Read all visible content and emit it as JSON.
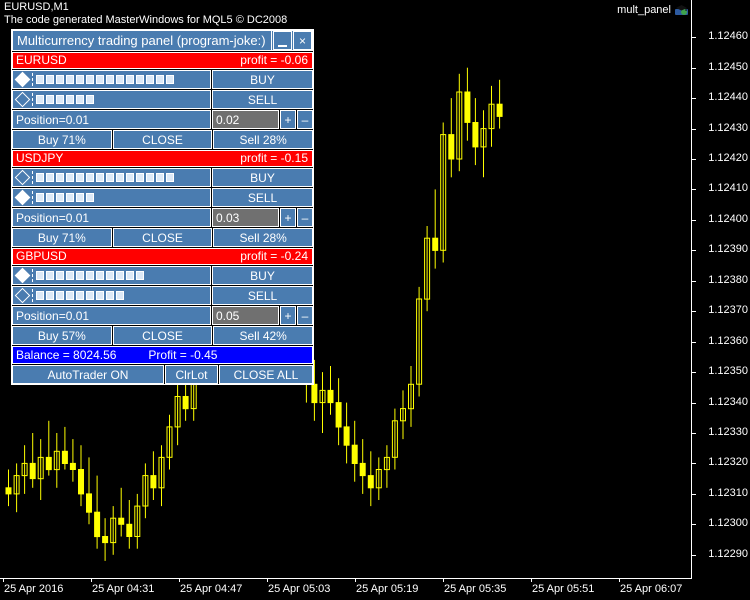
{
  "chart": {
    "symbol_label": "EURUSD,M1",
    "copyright": "The code generated MasterWindows for MQL5 © DC2008",
    "indicator_label": "mult_panel",
    "indicator_icon": "expert-advisor-icon",
    "background": "#000000",
    "candle_color": "#FFFF00"
  },
  "chart_data": {
    "type": "candlestick",
    "title": "EURUSD,M1",
    "xlabel": "",
    "ylabel": "",
    "grid": false,
    "legend": "none",
    "ylim": [
      1.12285,
      1.12465
    ],
    "price_ticks": [
      "1.12460",
      "1.12450",
      "1.12440",
      "1.12430",
      "1.12420",
      "1.12410",
      "1.12400",
      "1.12390",
      "1.12380",
      "1.12370",
      "1.12360",
      "1.12350",
      "1.12340",
      "1.12330",
      "1.12320",
      "1.12310",
      "1.12300",
      "1.12290"
    ],
    "time_ticks": [
      "25 Apr 2016",
      "25 Apr 04:31",
      "25 Apr 04:47",
      "25 Apr 05:03",
      "25 Apr 05:19",
      "25 Apr 05:35",
      "25 Apr 05:51",
      "25 Apr 06:07"
    ],
    "candles": [
      {
        "o": 1.12312,
        "h": 1.12318,
        "l": 1.12306,
        "c": 1.1231
      },
      {
        "o": 1.1231,
        "h": 1.1232,
        "l": 1.12304,
        "c": 1.12316
      },
      {
        "o": 1.12316,
        "h": 1.12326,
        "l": 1.1231,
        "c": 1.1232
      },
      {
        "o": 1.1232,
        "h": 1.1233,
        "l": 1.12312,
        "c": 1.12315
      },
      {
        "o": 1.12315,
        "h": 1.12328,
        "l": 1.12308,
        "c": 1.12322
      },
      {
        "o": 1.12322,
        "h": 1.12334,
        "l": 1.12316,
        "c": 1.12318
      },
      {
        "o": 1.12318,
        "h": 1.1233,
        "l": 1.12312,
        "c": 1.12324
      },
      {
        "o": 1.12324,
        "h": 1.12332,
        "l": 1.12318,
        "c": 1.1232
      },
      {
        "o": 1.1232,
        "h": 1.12328,
        "l": 1.12314,
        "c": 1.12318
      },
      {
        "o": 1.12318,
        "h": 1.12326,
        "l": 1.12306,
        "c": 1.1231
      },
      {
        "o": 1.1231,
        "h": 1.12322,
        "l": 1.123,
        "c": 1.12304
      },
      {
        "o": 1.12304,
        "h": 1.12316,
        "l": 1.12292,
        "c": 1.12296
      },
      {
        "o": 1.12296,
        "h": 1.12302,
        "l": 1.12288,
        "c": 1.12294
      },
      {
        "o": 1.12294,
        "h": 1.12306,
        "l": 1.1229,
        "c": 1.12302
      },
      {
        "o": 1.12302,
        "h": 1.12312,
        "l": 1.12296,
        "c": 1.123
      },
      {
        "o": 1.123,
        "h": 1.12308,
        "l": 1.12292,
        "c": 1.12296
      },
      {
        "o": 1.12296,
        "h": 1.1231,
        "l": 1.12292,
        "c": 1.12306
      },
      {
        "o": 1.12306,
        "h": 1.1232,
        "l": 1.12302,
        "c": 1.12316
      },
      {
        "o": 1.12316,
        "h": 1.12324,
        "l": 1.12308,
        "c": 1.12312
      },
      {
        "o": 1.12312,
        "h": 1.12326,
        "l": 1.12306,
        "c": 1.12322
      },
      {
        "o": 1.12322,
        "h": 1.12336,
        "l": 1.12318,
        "c": 1.12332
      },
      {
        "o": 1.12332,
        "h": 1.12346,
        "l": 1.12326,
        "c": 1.12342
      },
      {
        "o": 1.12342,
        "h": 1.12352,
        "l": 1.12334,
        "c": 1.12338
      },
      {
        "o": 1.12338,
        "h": 1.1236,
        "l": 1.12334,
        "c": 1.12356
      },
      {
        "o": 1.12356,
        "h": 1.12396,
        "l": 1.12352,
        "c": 1.12392
      },
      {
        "o": 1.12392,
        "h": 1.12412,
        "l": 1.12386,
        "c": 1.12408
      },
      {
        "o": 1.12408,
        "h": 1.12424,
        "l": 1.12396,
        "c": 1.12404
      },
      {
        "o": 1.12404,
        "h": 1.12452,
        "l": 1.124,
        "c": 1.12446
      },
      {
        "o": 1.12446,
        "h": 1.12458,
        "l": 1.1243,
        "c": 1.12436
      },
      {
        "o": 1.12436,
        "h": 1.12448,
        "l": 1.12414,
        "c": 1.1242
      },
      {
        "o": 1.1242,
        "h": 1.12432,
        "l": 1.12406,
        "c": 1.12412
      },
      {
        "o": 1.12412,
        "h": 1.12424,
        "l": 1.124,
        "c": 1.12406
      },
      {
        "o": 1.12406,
        "h": 1.12418,
        "l": 1.1238,
        "c": 1.12386
      },
      {
        "o": 1.12386,
        "h": 1.12392,
        "l": 1.12366,
        "c": 1.12372
      },
      {
        "o": 1.12372,
        "h": 1.1238,
        "l": 1.1236,
        "c": 1.12366
      },
      {
        "o": 1.12366,
        "h": 1.12374,
        "l": 1.12356,
        "c": 1.12362
      },
      {
        "o": 1.12362,
        "h": 1.1237,
        "l": 1.12348,
        "c": 1.12354
      },
      {
        "o": 1.12354,
        "h": 1.12362,
        "l": 1.1234,
        "c": 1.12346
      },
      {
        "o": 1.12346,
        "h": 1.12354,
        "l": 1.12334,
        "c": 1.1234
      },
      {
        "o": 1.1234,
        "h": 1.1235,
        "l": 1.1233,
        "c": 1.12344
      },
      {
        "o": 1.12344,
        "h": 1.12352,
        "l": 1.12336,
        "c": 1.1234
      },
      {
        "o": 1.1234,
        "h": 1.12348,
        "l": 1.12326,
        "c": 1.12332
      },
      {
        "o": 1.12332,
        "h": 1.1234,
        "l": 1.1232,
        "c": 1.12326
      },
      {
        "o": 1.12326,
        "h": 1.12334,
        "l": 1.12314,
        "c": 1.1232
      },
      {
        "o": 1.1232,
        "h": 1.12328,
        "l": 1.1231,
        "c": 1.12316
      },
      {
        "o": 1.12316,
        "h": 1.12324,
        "l": 1.12306,
        "c": 1.12312
      },
      {
        "o": 1.12312,
        "h": 1.12322,
        "l": 1.12308,
        "c": 1.12318
      },
      {
        "o": 1.12318,
        "h": 1.12326,
        "l": 1.12312,
        "c": 1.12322
      },
      {
        "o": 1.12322,
        "h": 1.12338,
        "l": 1.12318,
        "c": 1.12334
      },
      {
        "o": 1.12334,
        "h": 1.12344,
        "l": 1.12328,
        "c": 1.12338
      },
      {
        "o": 1.12338,
        "h": 1.12352,
        "l": 1.12332,
        "c": 1.12346
      },
      {
        "o": 1.12346,
        "h": 1.12378,
        "l": 1.12342,
        "c": 1.12374
      },
      {
        "o": 1.12374,
        "h": 1.12398,
        "l": 1.1237,
        "c": 1.12394
      },
      {
        "o": 1.12394,
        "h": 1.1241,
        "l": 1.12384,
        "c": 1.1239
      },
      {
        "o": 1.1239,
        "h": 1.12432,
        "l": 1.12386,
        "c": 1.12428
      },
      {
        "o": 1.12428,
        "h": 1.1244,
        "l": 1.12414,
        "c": 1.1242
      },
      {
        "o": 1.1242,
        "h": 1.12448,
        "l": 1.12416,
        "c": 1.12442
      },
      {
        "o": 1.12442,
        "h": 1.1245,
        "l": 1.12426,
        "c": 1.12432
      },
      {
        "o": 1.12432,
        "h": 1.1244,
        "l": 1.12418,
        "c": 1.12424
      },
      {
        "o": 1.12424,
        "h": 1.12436,
        "l": 1.12414,
        "c": 1.1243
      },
      {
        "o": 1.1243,
        "h": 1.12444,
        "l": 1.12424,
        "c": 1.12438
      },
      {
        "o": 1.12438,
        "h": 1.12446,
        "l": 1.1243,
        "c": 1.12434
      }
    ]
  },
  "panel": {
    "title": "Multicurrency trading panel (program-joke:)",
    "minimize_label": "minimize",
    "close_label": "×",
    "symbols": [
      {
        "name": "EURUSD",
        "profit": "profit = -0.06",
        "buy_selected": true,
        "sell_selected": false,
        "buy_blocks": 14,
        "sell_blocks": 6,
        "buy_label": "BUY",
        "sell_label": "SELL",
        "position_label": "Position=0.01",
        "lot": "0.02",
        "plus_label": "+",
        "minus_label": "–",
        "buy_pct_label": "Buy 71%",
        "close_label": "CLOSE",
        "sell_pct_label": "Sell 28%"
      },
      {
        "name": "USDJPY",
        "profit": "profit = -0.15",
        "buy_selected": false,
        "sell_selected": true,
        "buy_blocks": 14,
        "sell_blocks": 6,
        "buy_label": "BUY",
        "sell_label": "SELL",
        "position_label": "Position=0.01",
        "lot": "0.03",
        "plus_label": "+",
        "minus_label": "–",
        "buy_pct_label": "Buy 71%",
        "close_label": "CLOSE",
        "sell_pct_label": "Sell 28%"
      },
      {
        "name": "GBPUSD",
        "profit": "profit = -0.24",
        "buy_selected": true,
        "sell_selected": false,
        "buy_blocks": 11,
        "sell_blocks": 9,
        "buy_label": "BUY",
        "sell_label": "SELL",
        "position_label": "Position=0.01",
        "lot": "0.05",
        "plus_label": "+",
        "minus_label": "–",
        "buy_pct_label": "Buy 57%",
        "close_label": "CLOSE",
        "sell_pct_label": "Sell 42%"
      }
    ],
    "balance": "Balance = 8024.56",
    "total_profit": "Profit = -0.45",
    "autotrader_label": "AutoTrader ON",
    "clrlot_label": "ClrLot",
    "closeall_label": "CLOSE ALL",
    "colors": {
      "header_red": "#FF0000",
      "button_blue": "#4A7CB0",
      "balance_blue": "#0000FF",
      "input_gray": "#707070",
      "border_white": "#FFFFFF"
    }
  }
}
